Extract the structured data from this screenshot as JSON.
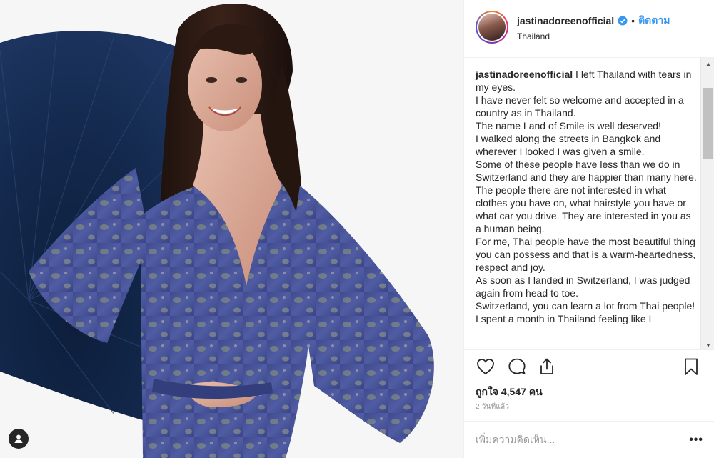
{
  "post": {
    "username": "jastinadoreenofficial",
    "follow_label": "ติดตาม",
    "dot_separator": "•",
    "location": "Thailand",
    "caption_lines": [
      "I left Thailand with tears in my eyes.",
      "I have never felt so welcome and accepted in a country as in Thailand.",
      "The name Land of Smile is well deserved!",
      "I walked along the streets in Bangkok and wherever I looked I was given a smile.",
      "Some of these people have less than we do in Switzerland and they are happier than many here.",
      "The people there are not interested in what clothes you have on, what hairstyle you have or what car you drive. They are interested in you as a human being.",
      "For me, Thai people have the most beautiful thing you can possess and that is a warm-heartedness, respect and joy.",
      "As soon as I landed in Switzerland, I was judged again from head to toe.",
      "Switzerland, you can learn a lot from Thai people!",
      "I spent a month in Thailand feeling like I"
    ],
    "likes_text": "ถูกใจ 4,547 คน",
    "timestamp": "2 วันที่แล้ว",
    "comment_placeholder": "เพิ่มความคิดเห็น...",
    "more_label": "•••"
  },
  "icons": {
    "verified": "verified-badge-icon",
    "like": "heart-icon",
    "comment": "comment-icon",
    "share": "share-icon",
    "save": "bookmark-icon",
    "user_tag": "user-tag-icon"
  },
  "colors": {
    "accent": "#3897f0",
    "text": "#262626",
    "muted": "#999999",
    "border": "#efefef"
  }
}
